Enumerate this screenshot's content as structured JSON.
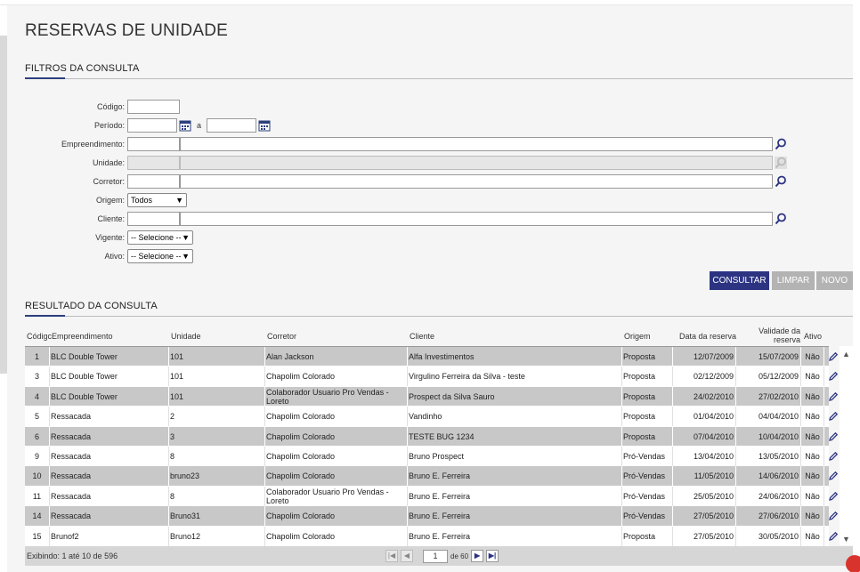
{
  "page": {
    "title": "RESERVAS DE UNIDADE"
  },
  "filters": {
    "section_title": "FILTROS DA CONSULTA",
    "codigo_label": "Código:",
    "periodo_label": "Período:",
    "periodo_sep": "a",
    "empreendimento_label": "Empreendimento:",
    "unidade_label": "Unidade:",
    "corretor_label": "Corretor:",
    "origem_label": "Origem:",
    "origem_value": "Todos",
    "cliente_label": "Cliente:",
    "vigente_label": "Vigente:",
    "vigente_value": "-- Selecione --",
    "ativo_label": "Ativo:",
    "ativo_value": "-- Selecione --"
  },
  "actions": {
    "consultar": "CONSULTAR",
    "limpar": "LIMPAR",
    "novo": "NOVO"
  },
  "results": {
    "section_title": "RESULTADO DA CONSULTA",
    "columns": [
      "Códigc",
      "Empreendimento",
      "Unidade",
      "Corretor",
      "Cliente",
      "Origem",
      "Data da reserva",
      "Validade da reserva",
      "Ativo"
    ],
    "rows": [
      {
        "codigo": "1",
        "empreendimento": "BLC Double Tower",
        "unidade": "101",
        "corretor": "Alan Jackson",
        "cliente": "Alfa Investimentos",
        "origem": "Proposta",
        "data": "12/07/2009",
        "validade": "15/07/2009",
        "ativo": "Não"
      },
      {
        "codigo": "3",
        "empreendimento": "BLC Double Tower",
        "unidade": "101",
        "corretor": "Chapolim Colorado",
        "cliente": "Virgulino Ferreira da Silva - teste",
        "origem": "Proposta",
        "data": "02/12/2009",
        "validade": "05/12/2009",
        "ativo": "Não"
      },
      {
        "codigo": "4",
        "empreendimento": "BLC Double Tower",
        "unidade": "101",
        "corretor": "Colaborador Usuario Pro Vendas - Loreto",
        "cliente": "Prospect da Silva Sauro",
        "origem": "Proposta",
        "data": "24/02/2010",
        "validade": "27/02/2010",
        "ativo": "Não"
      },
      {
        "codigo": "5",
        "empreendimento": "Ressacada",
        "unidade": "2",
        "corretor": "Chapolim Colorado",
        "cliente": "Vandinho",
        "origem": "Proposta",
        "data": "01/04/2010",
        "validade": "04/04/2010",
        "ativo": "Não"
      },
      {
        "codigo": "6",
        "empreendimento": "Ressacada",
        "unidade": "3",
        "corretor": "Chapolim Colorado",
        "cliente": "TESTE BUG 1234",
        "origem": "Proposta",
        "data": "07/04/2010",
        "validade": "10/04/2010",
        "ativo": "Não"
      },
      {
        "codigo": "9",
        "empreendimento": "Ressacada",
        "unidade": "8",
        "corretor": "Chapolim Colorado",
        "cliente": "Bruno Prospect",
        "origem": "Pró-Vendas",
        "data": "13/04/2010",
        "validade": "13/05/2010",
        "ativo": "Não"
      },
      {
        "codigo": "10",
        "empreendimento": "Ressacada",
        "unidade": "bruno23",
        "corretor": "Chapolim Colorado",
        "cliente": "Bruno E. Ferreira",
        "origem": "Pró-Vendas",
        "data": "11/05/2010",
        "validade": "14/06/2010",
        "ativo": "Não"
      },
      {
        "codigo": "11",
        "empreendimento": "Ressacada",
        "unidade": "8",
        "corretor": "Colaborador Usuario Pro Vendas - Loreto",
        "cliente": "Bruno E. Ferreira",
        "origem": "Pró-Vendas",
        "data": "25/05/2010",
        "validade": "24/06/2010",
        "ativo": "Não"
      },
      {
        "codigo": "14",
        "empreendimento": "Ressacada",
        "unidade": "Bruno31",
        "corretor": "Chapolim Colorado",
        "cliente": "Bruno E. Ferreira",
        "origem": "Pró-Vendas",
        "data": "27/05/2010",
        "validade": "27/06/2010",
        "ativo": "Não"
      },
      {
        "codigo": "15",
        "empreendimento": "Brunof2",
        "unidade": "Bruno12",
        "corretor": "Chapolim Colorado",
        "cliente": "Bruno E. Ferreira",
        "origem": "Proposta",
        "data": "27/05/2010",
        "validade": "30/05/2010",
        "ativo": "Não"
      }
    ]
  },
  "pagination": {
    "info": "Exibindo: 1 até 10 de 596",
    "page": "1",
    "of": "de 60"
  },
  "icons": {
    "calendar": "calendar-icon",
    "search": "search-icon",
    "edit": "edit-icon",
    "first": "first-page-icon",
    "prev": "prev-page-icon",
    "next": "next-page-icon",
    "last": "last-page-icon"
  },
  "colors": {
    "primary": "#2c3482",
    "accent": "#2c3e7d",
    "row_alt": "#c8c8c8",
    "button_disabled": "#b3b3b3"
  }
}
